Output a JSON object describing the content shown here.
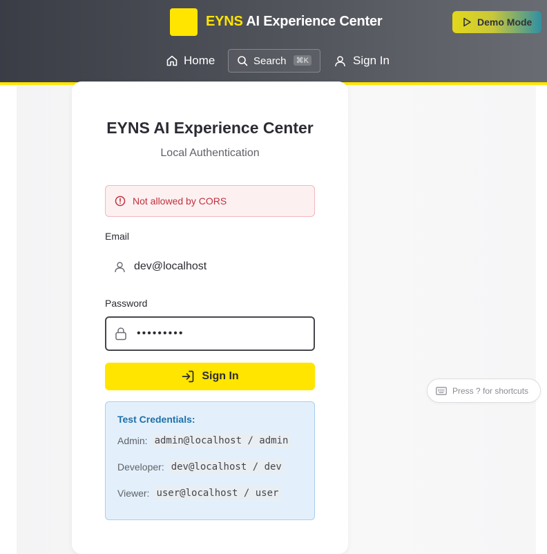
{
  "header": {
    "brand_accent": "EYNS",
    "brand_rest": " AI Experience Center",
    "demo_label": "Demo Mode",
    "nav": {
      "home": "Home",
      "search": "Search",
      "search_shortcut": "⌘K",
      "signin": "Sign In"
    }
  },
  "login": {
    "title": "EYNS AI Experience Center",
    "subtitle": "Local Authentication",
    "error": "Not allowed by CORS",
    "email_label": "Email",
    "email_value": "dev@localhost",
    "password_label": "Password",
    "password_value": "•••••••••",
    "submit_label": "Sign In"
  },
  "credentials": {
    "title": "Test Credentials:",
    "rows": [
      {
        "role": "Admin:",
        "value": "admin@localhost / admin"
      },
      {
        "role": "Developer:",
        "value": "dev@localhost / dev"
      },
      {
        "role": "Viewer:",
        "value": "user@localhost / user"
      }
    ]
  },
  "shortcuts_hint": "Press ? for shortcuts",
  "colors": {
    "accent": "#ffe500",
    "header_bg": "#3b3d46",
    "error": "#c0303c",
    "info": "#1f6fa8"
  },
  "icons": [
    "logo-icon",
    "play-icon",
    "home-icon",
    "search-icon",
    "user-icon",
    "alert-icon",
    "lock-icon",
    "sign-in-icon",
    "keyboard-icon"
  ]
}
